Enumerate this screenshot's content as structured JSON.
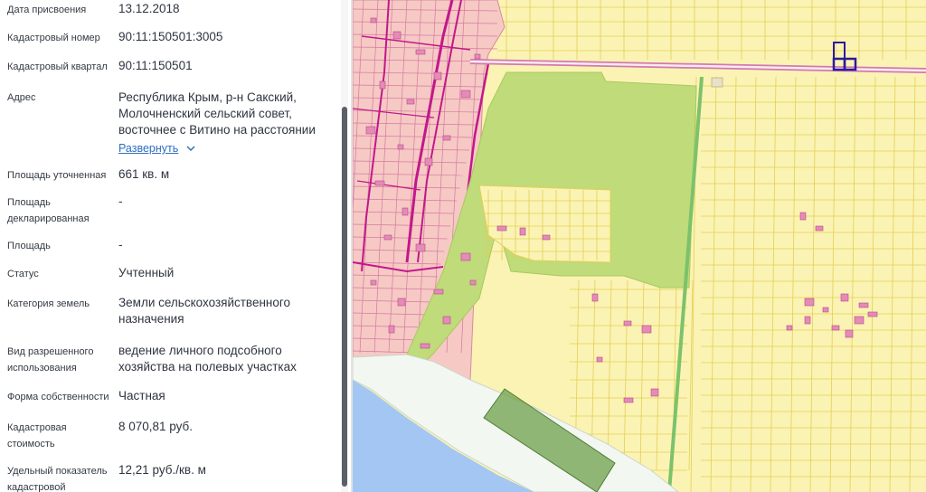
{
  "rows": [
    {
      "label_lines": [
        "Дата присвоения"
      ],
      "value_lines": [
        "13.12.2018"
      ]
    },
    {
      "label_lines": [
        "Кадастровый номер"
      ],
      "value_lines": [
        "90:11:150501:3005"
      ]
    },
    {
      "label_lines": [
        "Кадастровый квартал"
      ],
      "value_lines": [
        "90:11:150501"
      ]
    },
    {
      "label_lines": [
        "Адрес"
      ],
      "value_lines": [
        "Республика Крым, р-н Сакский,",
        "Молочненский сельский совет,",
        "восточнее с Витино на расстоянии"
      ],
      "expand_label": "Развернуть"
    },
    {
      "label_lines": [
        "Площадь уточненная"
      ],
      "value_lines": [
        "661 кв. м"
      ]
    },
    {
      "label_lines": [
        "Площадь",
        "декларированная"
      ],
      "value_lines": [
        "-"
      ]
    },
    {
      "label_lines": [
        "Площадь"
      ],
      "value_lines": [
        "-"
      ]
    },
    {
      "label_lines": [
        "Статус"
      ],
      "value_lines": [
        "Учтенный"
      ]
    },
    {
      "label_lines": [
        "Категория земель"
      ],
      "value_lines": [
        "Земли сельскохозяйственного",
        "назначения"
      ]
    },
    {
      "label_lines": [
        "Вид разрешенного",
        "использования"
      ],
      "value_lines": [
        "ведение личного подсобного",
        "хозяйства на полевых участках"
      ]
    },
    {
      "label_lines": [
        "Форма собственности"
      ],
      "value_lines": [
        "Частная"
      ]
    },
    {
      "label_lines": [
        "Кадастровая",
        "стоимость"
      ],
      "value_lines": [
        "8 070,81 руб."
      ]
    },
    {
      "label_lines": [
        "Удельный показатель",
        "кадастровой"
      ],
      "value_lines": [
        "12,21 руб./кв. м"
      ]
    }
  ],
  "icons": {
    "expand": "chevron-down-icon"
  },
  "colors": {
    "map_background": "#fbf3b4",
    "parcel_outline": "#e3cf55",
    "settlement_fill": "#f6c9c4",
    "road_magenta": "#c2188a",
    "green_area": "#bfdb7a",
    "water": "#a3c7f2",
    "selected_parcel": "#2c1a9e",
    "highlight_parcel": "#6ea04a"
  }
}
